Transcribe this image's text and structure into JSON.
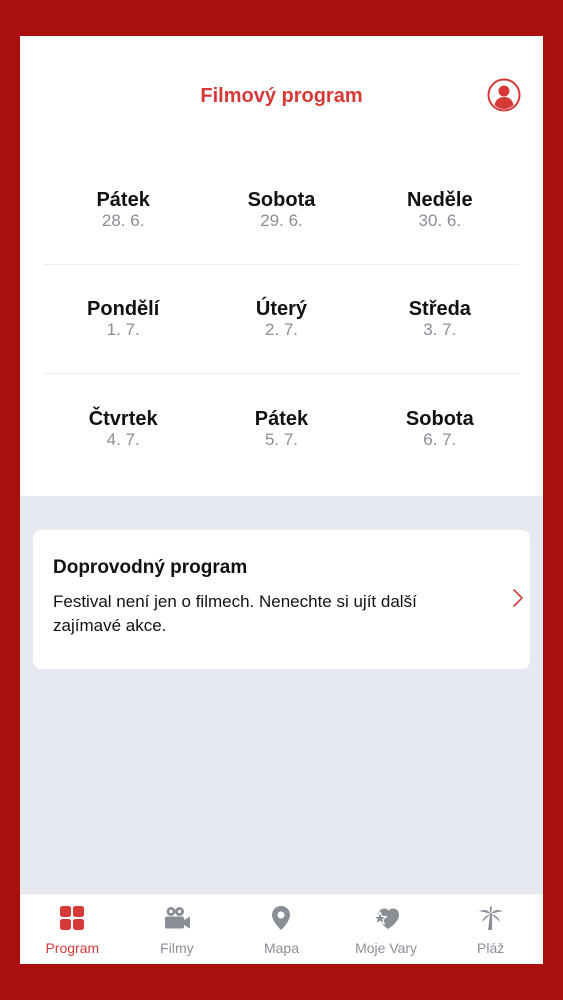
{
  "header": {
    "title": "Filmový program",
    "profile_icon": "user-icon"
  },
  "days": {
    "rows": [
      [
        {
          "name": "Pátek",
          "date": "28. 6."
        },
        {
          "name": "Sobota",
          "date": "29. 6."
        },
        {
          "name": "Neděle",
          "date": "30. 6."
        }
      ],
      [
        {
          "name": "Pondělí",
          "date": "1. 7."
        },
        {
          "name": "Úterý",
          "date": "2. 7."
        },
        {
          "name": "Středa",
          "date": "3. 7."
        }
      ],
      [
        {
          "name": "Čtvrtek",
          "date": "4. 7."
        },
        {
          "name": "Pátek",
          "date": "5. 7."
        },
        {
          "name": "Sobota",
          "date": "6. 7."
        }
      ]
    ]
  },
  "card": {
    "title": "Doprovodný program",
    "text": "Festival není jen o filmech. Nenechte si ujít další zajímavé akce.",
    "icon": "chevron-right-icon"
  },
  "tabs": [
    {
      "label": "Program",
      "icon": "grid-icon",
      "active": true
    },
    {
      "label": "Filmy",
      "icon": "video-camera-icon",
      "active": false
    },
    {
      "label": "Mapa",
      "icon": "map-pin-icon",
      "active": false
    },
    {
      "label": "Moje Vary",
      "icon": "heart-star-icon",
      "active": false
    },
    {
      "label": "Pláž",
      "icon": "palm-tree-icon",
      "active": false
    }
  ],
  "colors": {
    "accent": "#d53a37",
    "frame": "#a80f0d",
    "inactive": "#8a8f96",
    "background": "#e6e9ef"
  }
}
